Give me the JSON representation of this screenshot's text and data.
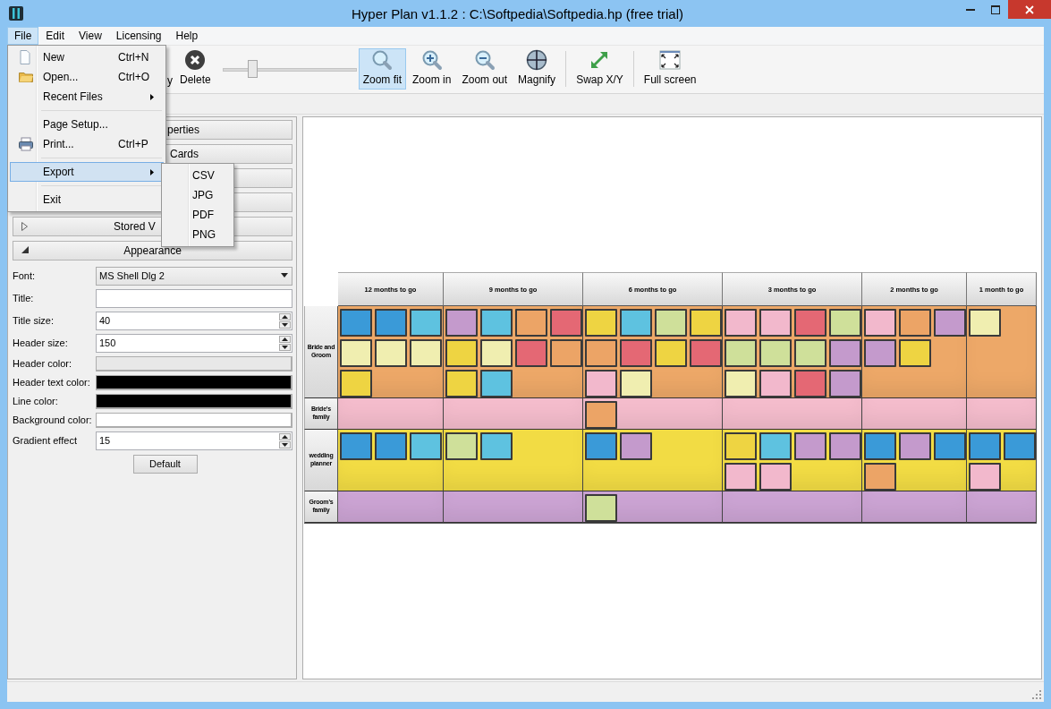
{
  "window": {
    "title": "Hyper Plan v1.1.2 : C:\\Softpedia\\Softpedia.hp (free trial)"
  },
  "menubar": [
    {
      "label": "File",
      "selected": true
    },
    {
      "label": "Edit",
      "selected": false
    },
    {
      "label": "View",
      "selected": false
    },
    {
      "label": "Licensing",
      "selected": false
    },
    {
      "label": "Help",
      "selected": false
    }
  ],
  "file_menu": [
    {
      "kind": "item",
      "label": "New",
      "shortcut": "Ctrl+N",
      "submenu": false,
      "selected": false
    },
    {
      "kind": "item",
      "label": "Open...",
      "shortcut": "Ctrl+O",
      "submenu": false,
      "selected": false
    },
    {
      "kind": "item",
      "label": "Recent Files",
      "submenu": true,
      "selected": false
    },
    {
      "kind": "separator"
    },
    {
      "kind": "item",
      "label": "Page Setup...",
      "submenu": false,
      "selected": false
    },
    {
      "kind": "item",
      "label": "Print...",
      "shortcut": "Ctrl+P",
      "submenu": false,
      "selected": false
    },
    {
      "kind": "separator"
    },
    {
      "kind": "item",
      "label": "Export",
      "submenu": true,
      "selected": true,
      "children": [
        {
          "label": "CSV"
        },
        {
          "label": "JPG"
        },
        {
          "label": "PDF"
        },
        {
          "label": "PNG"
        }
      ]
    },
    {
      "kind": "separator"
    },
    {
      "kind": "item",
      "label": "Exit",
      "submenu": false,
      "selected": false
    }
  ],
  "toolbar": [
    {
      "kind": "button",
      "label": "y",
      "active": false
    },
    {
      "kind": "button",
      "label": "Delete",
      "active": false
    },
    {
      "kind": "slider",
      "level": 0.22
    },
    {
      "kind": "button",
      "label": "Zoom fit",
      "active": true
    },
    {
      "kind": "button",
      "label": "Zoom in",
      "active": false
    },
    {
      "kind": "button",
      "label": "Zoom out",
      "active": false
    },
    {
      "kind": "button",
      "label": "Magnify",
      "active": false
    },
    {
      "kind": "separator"
    },
    {
      "kind": "button",
      "label": "Swap X/Y",
      "active": false
    },
    {
      "kind": "separator"
    },
    {
      "kind": "button",
      "label": "Full screen",
      "active": false
    }
  ],
  "sidebar": {
    "sections": [
      {
        "kind": "section",
        "label": "perties"
      },
      {
        "kind": "section",
        "label": "Cards"
      },
      {
        "kind": "section"
      },
      {
        "kind": "section"
      },
      {
        "kind": "section",
        "label": "Stored V",
        "expanded": false
      },
      {
        "kind": "section",
        "label": "Appearance",
        "expanded": true
      }
    ],
    "fields": [
      {
        "label": "Font:",
        "kind": "combo",
        "value": "MS Shell Dlg 2"
      },
      {
        "label": "Title:",
        "kind": "text"
      },
      {
        "label": "Title size:",
        "kind": "spin",
        "value": "40"
      },
      {
        "label": "Header size:",
        "kind": "spin",
        "value": "150"
      },
      {
        "label": "Header color:",
        "kind": "color",
        "color": "#e8e8e8"
      },
      {
        "label": "Header text color:",
        "kind": "color",
        "color": "#000000"
      },
      {
        "label": "Line color:",
        "kind": "color",
        "color": "#000000"
      },
      {
        "label": "Background color:",
        "kind": "color",
        "color": "#ffffff"
      },
      {
        "label": "Gradient effect",
        "kind": "spin",
        "value": "15"
      }
    ],
    "default_button": "Default"
  },
  "board": {
    "columns": [
      "12 months to go",
      "9 months to go",
      "6 months to go",
      "3 months to go",
      "2 months to go",
      "1 month to go"
    ],
    "rows": [
      {
        "label": "Bride and Groom",
        "color": "#eda868",
        "cells": [
          [
            {
              "color": "#3a9ad8"
            },
            {
              "color": "#3a9ad8"
            },
            {
              "color": "#5ec2e0"
            },
            {
              "color": "#f0eeb0"
            },
            {
              "color": "#f0eeb0"
            },
            {
              "color": "#f0eeb0"
            },
            {
              "color": "#eed442"
            }
          ],
          [
            {
              "color": "#c49acc"
            },
            {
              "color": "#5ec2e0"
            },
            {
              "color": "#eca466"
            },
            {
              "color": "#e46874"
            },
            {
              "color": "#eed442"
            },
            {
              "color": "#f0eeb0"
            },
            {
              "color": "#e46874"
            },
            {
              "color": "#eca466"
            },
            {
              "color": "#eed442"
            },
            {
              "color": "#5ec2e0"
            }
          ],
          [
            {
              "color": "#eed442"
            },
            {
              "color": "#5ec2e0"
            },
            {
              "color": "#cfe09a"
            },
            {
              "color": "#eed442"
            },
            {
              "color": "#eca466"
            },
            {
              "color": "#e46874"
            },
            {
              "color": "#eed442"
            },
            {
              "color": "#e46874"
            },
            {
              "color": "#f2b8cc"
            },
            {
              "color": "#f0eeb0"
            }
          ],
          [
            {
              "color": "#f2b8cc"
            },
            {
              "color": "#f2b8cc"
            },
            {
              "color": "#e46874"
            },
            {
              "color": "#cfe09a"
            },
            {
              "color": "#cfe09a"
            },
            {
              "color": "#cfe09a"
            },
            {
              "color": "#cfe09a"
            },
            {
              "color": "#c49acc"
            },
            {
              "color": "#f0eeb0"
            },
            {
              "color": "#f2b8cc"
            },
            {
              "color": "#e46874"
            },
            {
              "color": "#c49acc"
            }
          ],
          [
            {
              "color": "#f2b8cc"
            },
            {
              "color": "#eca466"
            },
            {
              "color": "#c49acc"
            },
            {
              "color": "#c49acc"
            },
            {
              "color": "#eed442"
            }
          ],
          [
            {
              "color": "#f0eeb0"
            }
          ]
        ]
      },
      {
        "label": "Bride's family",
        "color": "#f4bccc",
        "cells": [
          [],
          [],
          [
            {
              "color": "#eca466"
            }
          ],
          [],
          [],
          []
        ]
      },
      {
        "label": "wedding planner",
        "color": "#f2dc44",
        "cells": [
          [
            {
              "color": "#3a9ad8"
            },
            {
              "color": "#3a9ad8"
            },
            {
              "color": "#5ec2e0"
            }
          ],
          [
            {
              "color": "#cfe09a"
            },
            {
              "color": "#5ec2e0"
            }
          ],
          [
            {
              "color": "#3a9ad8"
            },
            {
              "color": "#c49acc"
            }
          ],
          [
            {
              "color": "#eed442"
            },
            {
              "color": "#5ec2e0"
            },
            {
              "color": "#c49acc"
            },
            {
              "color": "#c49acc"
            },
            {
              "color": "#f2b8cc"
            },
            {
              "color": "#f2b8cc"
            }
          ],
          [
            {
              "color": "#3a9ad8"
            },
            {
              "color": "#c49acc"
            },
            {
              "color": "#3a9ad8"
            },
            {
              "color": "#eca466"
            }
          ],
          [
            {
              "color": "#3a9ad8"
            },
            {
              "color": "#3a9ad8"
            },
            {
              "color": "#f2b8cc"
            }
          ]
        ]
      },
      {
        "label": "Groom's family",
        "color": "#cca4d4",
        "cells": [
          [],
          [],
          [
            {
              "color": "#cfe09a"
            }
          ],
          [],
          [],
          []
        ]
      }
    ]
  }
}
